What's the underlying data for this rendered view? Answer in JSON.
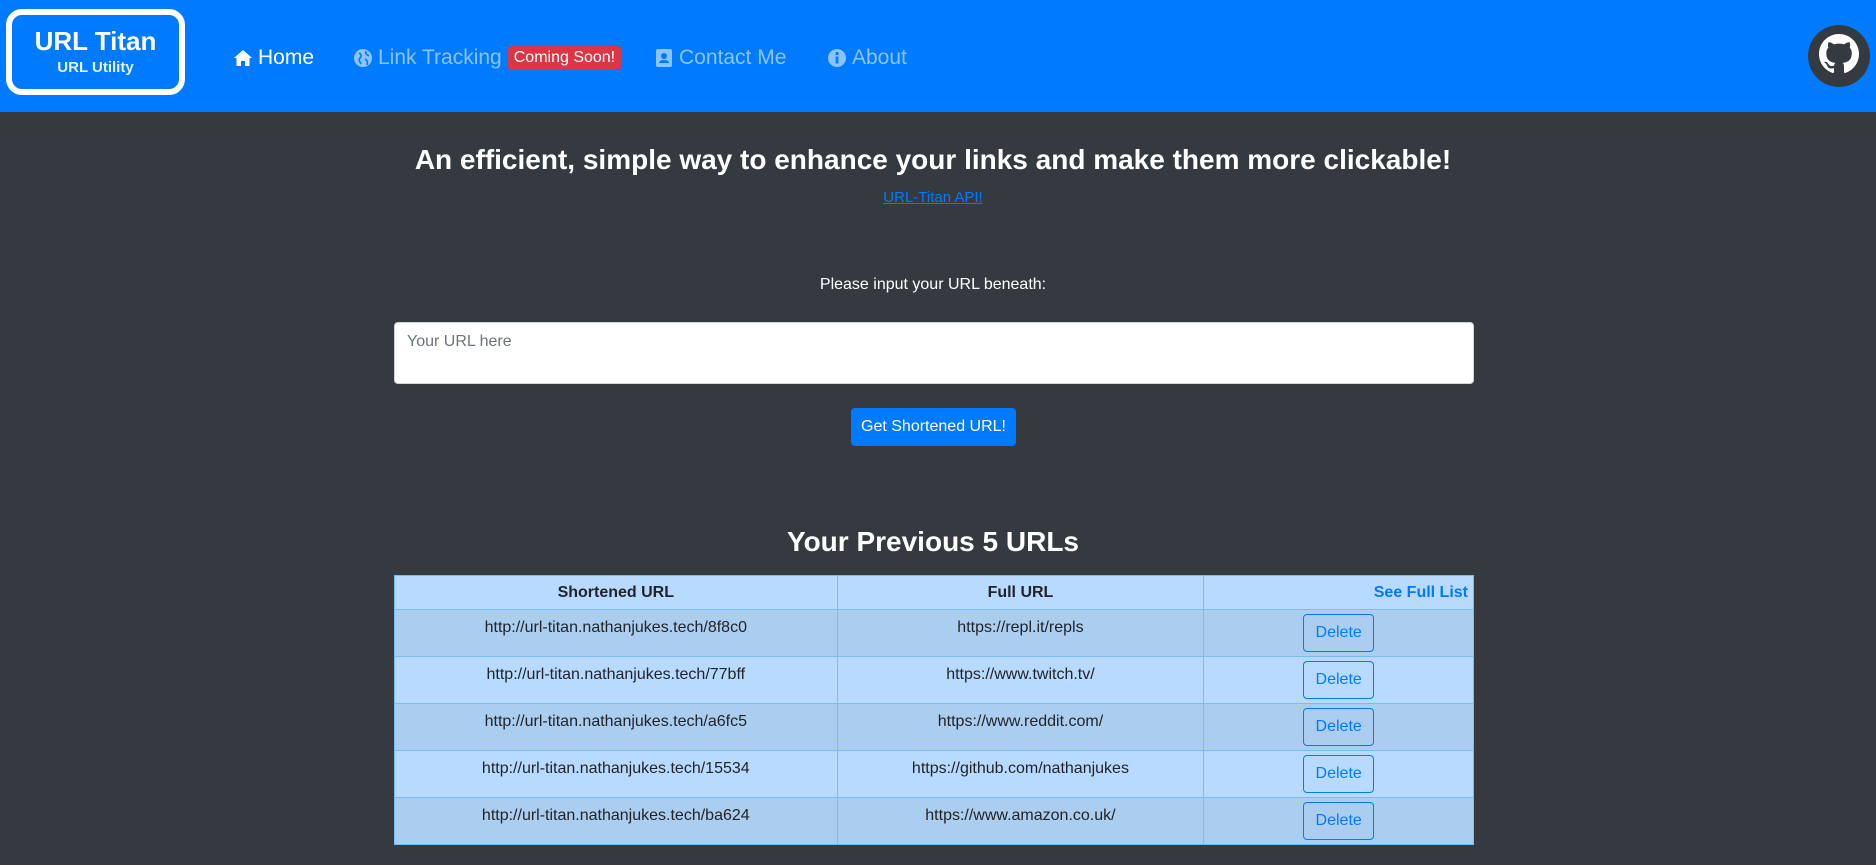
{
  "brand": {
    "title": "URL Titan",
    "subtitle": "URL Utility"
  },
  "nav": {
    "home": {
      "label": "Home",
      "icon": "home-icon"
    },
    "tracking": {
      "label": "Link Tracking",
      "icon": "globe-icon",
      "badge": "Coming Soon!"
    },
    "contact": {
      "label": "Contact Me",
      "icon": "address-book-icon"
    },
    "about": {
      "label": "About",
      "icon": "info-circle-icon"
    },
    "github_icon": "github-icon"
  },
  "hero": {
    "headline": "An efficient, simple way to enhance your links and make them more clickable!",
    "api_link": "URL-Titan API!"
  },
  "form": {
    "prompt": "Please input your URL beneath:",
    "placeholder": "Your URL here",
    "value": "",
    "submit_label": "Get Shortened URL!"
  },
  "history": {
    "title": "Your Previous 5 URLs",
    "headers": {
      "short": "Shortened URL",
      "full": "Full URL",
      "action": "See Full List"
    },
    "delete_label": "Delete",
    "rows": [
      {
        "short": "http://url-titan.nathanjukes.tech/8f8c0",
        "full": "https://repl.it/repls"
      },
      {
        "short": "http://url-titan.nathanjukes.tech/77bff",
        "full": "https://www.twitch.tv/"
      },
      {
        "short": "http://url-titan.nathanjukes.tech/a6fc5",
        "full": "https://www.reddit.com/"
      },
      {
        "short": "http://url-titan.nathanjukes.tech/15534",
        "full": "https://github.com/nathanjukes"
      },
      {
        "short": "http://url-titan.nathanjukes.tech/ba624",
        "full": "https://www.amazon.co.uk/"
      }
    ]
  },
  "colors": {
    "primary": "#007bff",
    "background": "#343a40",
    "badge": "#dc3545",
    "table_row": "#b8daff",
    "table_row_alt": "#abcdf0",
    "table_border": "#7abaff"
  }
}
